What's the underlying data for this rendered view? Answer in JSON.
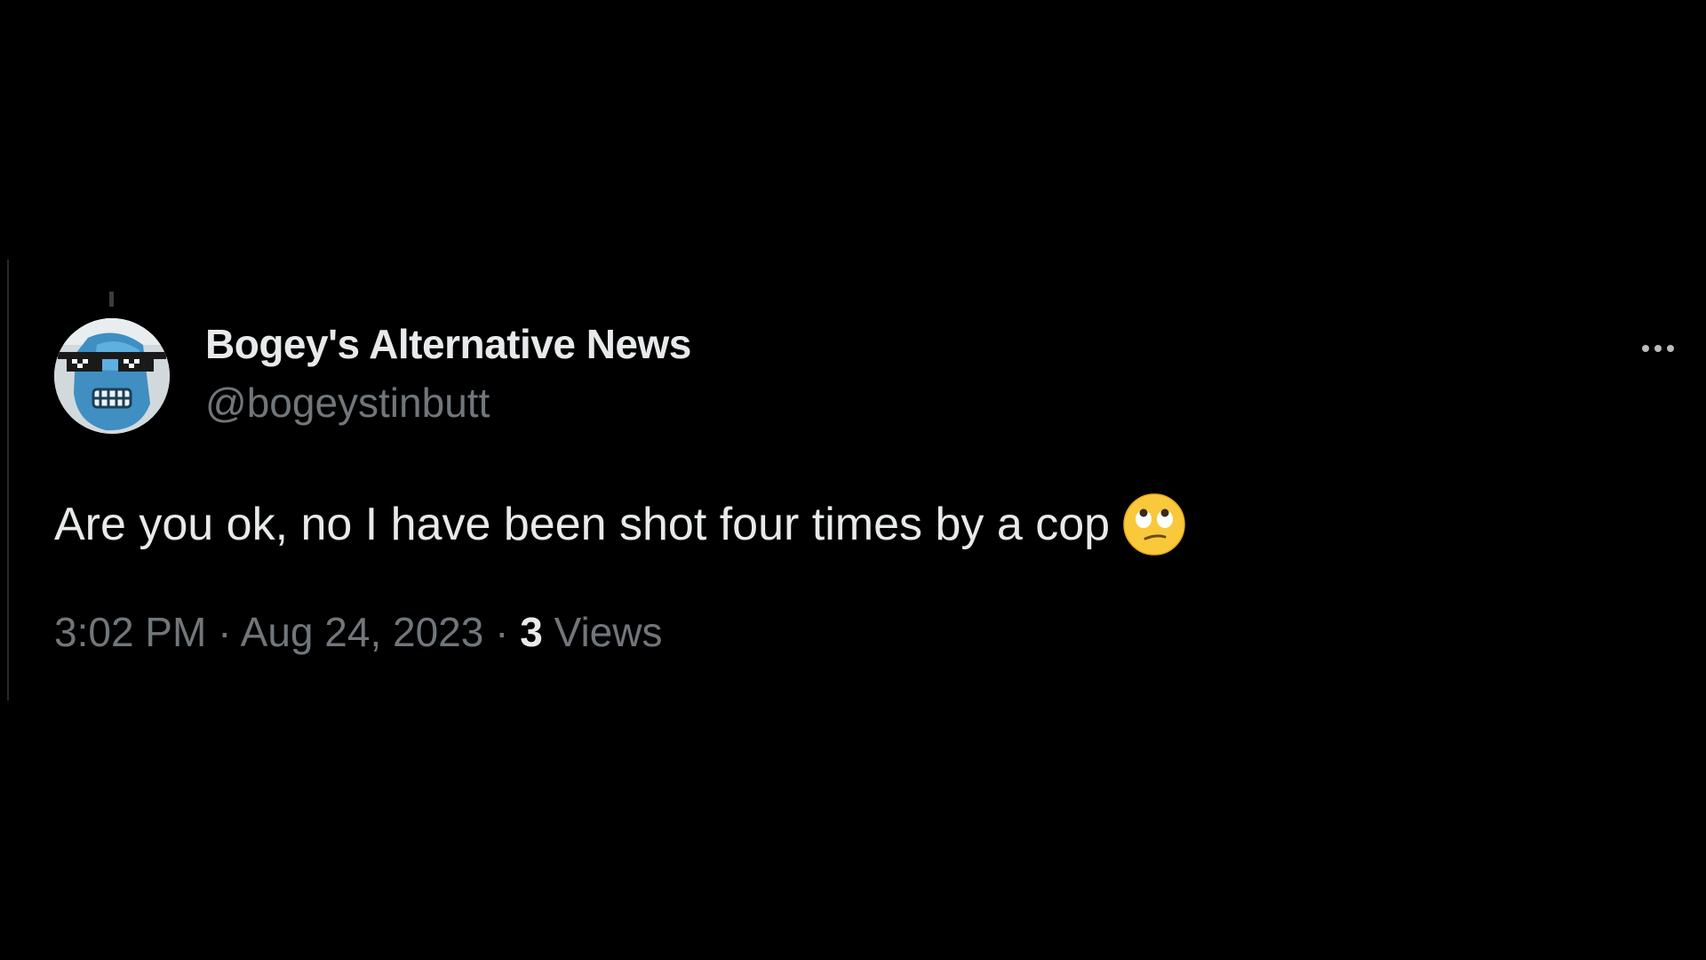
{
  "tweet": {
    "display_name": "Bogey's Alternative News",
    "handle": "@bogeystinbutt",
    "text": "Are you ok, no I have been shot four times by a cop",
    "emoji": "face-with-rolling-eyes",
    "time": "3:02 PM",
    "separator_1": " · ",
    "date": "Aug 24, 2023",
    "separator_2": " · ",
    "views_count": "3",
    "views_label": " Views"
  },
  "icons": {
    "more": "more-options-icon",
    "avatar": "avatar"
  },
  "colors": {
    "background": "#000000",
    "primary_text": "#e7e9ea",
    "secondary_text": "#71767b",
    "emoji_yellow": "#f9c93b"
  }
}
